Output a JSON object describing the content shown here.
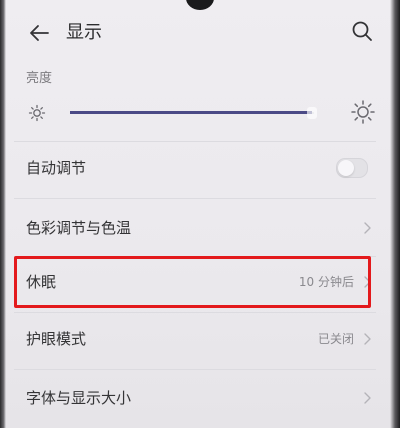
{
  "header": {
    "title": "显示",
    "back_icon": "arrow-left-icon",
    "search_icon": "search-icon"
  },
  "brightness": {
    "label": "亮度",
    "level": 0.99,
    "low_icon": "sun-small-icon",
    "high_icon": "sun-large-icon"
  },
  "rows": [
    {
      "label": "自动调节",
      "control": "toggle",
      "toggle_on": false
    },
    {
      "label": "色彩调节与色温",
      "value": ""
    },
    {
      "label": "休眠",
      "value": "10 分钟后"
    },
    {
      "label": "护眼模式",
      "value": "已关闭"
    },
    {
      "label": "字体与显示大小",
      "value": ""
    }
  ],
  "colors": {
    "accent": "#4b4a86",
    "highlight": "#e3191c"
  }
}
